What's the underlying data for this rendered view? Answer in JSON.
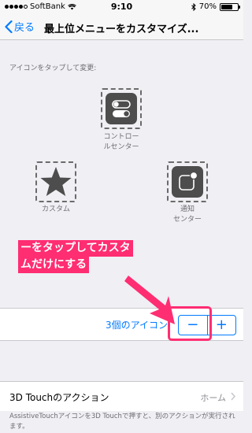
{
  "status_bar": {
    "carrier": "SoftBank",
    "time": "9:10",
    "battery": "70%",
    "battery_level": 0.7,
    "signal_bars": 4,
    "signal_total": 5
  },
  "nav": {
    "back_label": "戻る",
    "title": "最上位メニューをカスタマイズ..."
  },
  "icons_section": {
    "label": "アイコンをタップして変更:",
    "items": [
      {
        "label_line1": "コントロー",
        "label_line2": "ルセンター",
        "icon": "control-center-icon"
      },
      {
        "label_line1": "カスタム",
        "label_line2": "",
        "icon": "star-icon"
      },
      {
        "label_line1": "通知",
        "label_line2": "センター",
        "icon": "notification-center-icon"
      }
    ]
  },
  "annotation": {
    "line1": "ーをタップしてカスタ",
    "line2": "ムだけにする"
  },
  "stepper_row": {
    "label": "3個のアイコン",
    "minus": "−",
    "plus": "+"
  },
  "touch_row": {
    "title": "3D Touchのアクション",
    "value": "ホーム"
  },
  "footnote": "AssistiveTouchアイコンを3D Touchで押すと、別のアクションが実行されます。",
  "colors": {
    "accent": "#007aff",
    "annotation": "#ff2d72",
    "icon_fill": "#4d4d4d",
    "background": "#efeff4"
  }
}
